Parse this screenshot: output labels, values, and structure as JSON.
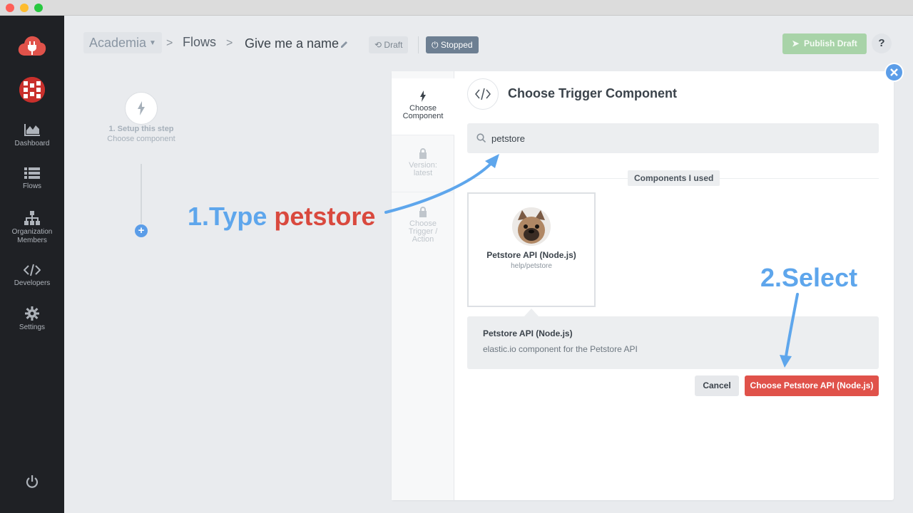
{
  "header": {
    "workspace": "Academia",
    "breadcrumb_sep": ">",
    "flows": "Flows",
    "flow_name": "Give me a name",
    "draft_label": "Draft",
    "stopped_label": "Stopped",
    "publish_label": "Publish Draft",
    "help_label": "?"
  },
  "sidebar": {
    "items": [
      {
        "label": "Dashboard",
        "icon": "chart-icon"
      },
      {
        "label": "Flows",
        "icon": "list-icon"
      },
      {
        "label": "Organization Members",
        "icon": "org-icon"
      },
      {
        "label": "Developers",
        "icon": "code-icon"
      },
      {
        "label": "Settings",
        "icon": "gear-icon"
      }
    ]
  },
  "canvas": {
    "step_title": "1. Setup this step",
    "step_sub": "Choose component",
    "add_label": "+"
  },
  "modal": {
    "tabs": [
      {
        "label": "Choose Component"
      },
      {
        "label": "Version: latest"
      },
      {
        "label": "Choose Trigger / Action"
      }
    ],
    "title": "Choose Trigger Component",
    "search": {
      "value": "petstore",
      "placeholder": ""
    },
    "section_label": "Components I used",
    "card": {
      "name": "Petstore API (Node.js)",
      "path": "help/petstore"
    },
    "details": {
      "title": "Petstore API (Node.js)",
      "description": "elastic.io component for the Petstore API"
    },
    "cancel_label": "Cancel",
    "choose_label": "Choose Petstore API (Node.js)"
  },
  "annotations": {
    "step1_prefix": "1.Type ",
    "step1_keyword": "petstore",
    "step2": "2.Select"
  },
  "colors": {
    "accent_blue": "#5ea6ec",
    "danger_red": "#e0524a",
    "publish_green": "#a8d3a8",
    "sidebar_bg": "#1f2125"
  }
}
